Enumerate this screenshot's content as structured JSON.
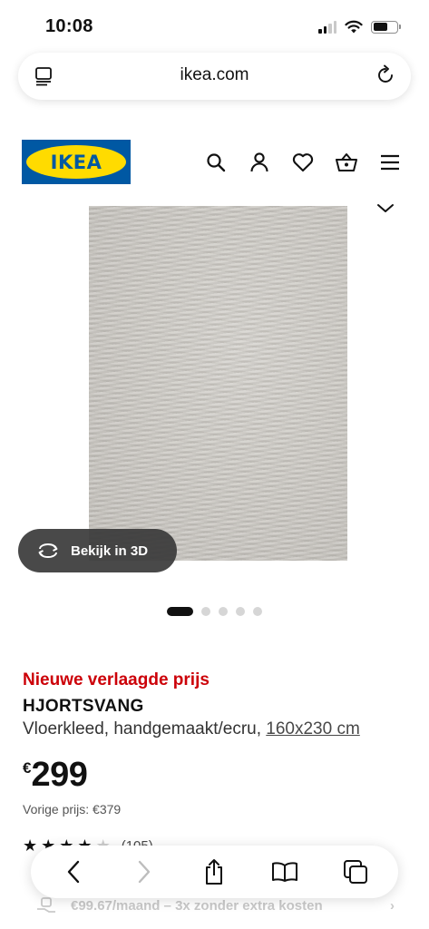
{
  "status_bar": {
    "time": "10:08"
  },
  "browser": {
    "url": "ikea.com"
  },
  "header": {
    "logo_text": "IKEA",
    "brand_blue": "#0058a3",
    "brand_yellow": "#ffdb00"
  },
  "gallery": {
    "view_3d_label": "Bekijk in 3D",
    "image_count": 5,
    "active_index": 0
  },
  "product": {
    "promo_label": "Nieuwe verlaagde prijs",
    "promo_color": "#cc0008",
    "name": "HJORTSVANG",
    "description": "Vloerkleed, handgemaakt/ecru,",
    "size": "160x230 cm",
    "price_currency": "€",
    "price_amount": "299",
    "previous_price": "Vorige prijs: €379",
    "rating_stars": 3.5,
    "rating_count": "(105)"
  },
  "finance": {
    "text": "€99.67/maand – 3x zonder extra kosten"
  },
  "toolbar": {
    "icons": [
      "back-icon",
      "forward-icon",
      "share-icon",
      "bookmarks-icon",
      "tabs-icon"
    ]
  }
}
